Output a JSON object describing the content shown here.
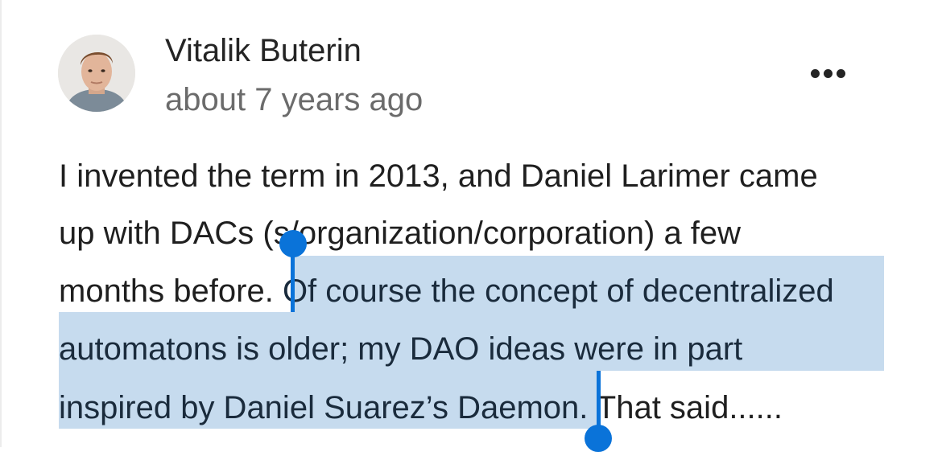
{
  "comment": {
    "author": "Vitalik Buterin",
    "timestamp": "about 7 years ago",
    "more_icon": "ellipsis-horizontal-icon",
    "lines": [
      {
        "pre": "I invented the term in 2013, and Daniel Larimer came",
        "sel": "",
        "post": ""
      },
      {
        "pre": "up with DACs (s/organization/corporation) a few",
        "sel": "",
        "post": ""
      },
      {
        "pre": "months before. ",
        "sel": "Of course the concept of decentralized",
        "post": ""
      },
      {
        "pre": "",
        "sel": "automatons is older; my DAO ideas were in part",
        "post": ""
      },
      {
        "pre": "",
        "sel": "inspired by Daniel Suarez’s Daemon.",
        "post": " That said......"
      }
    ]
  },
  "selection": {
    "highlight_color": "#c6dbee",
    "handle_color": "#0a73d9",
    "start_handle_icon": "selection-start-handle",
    "end_handle_icon": "selection-end-handle"
  }
}
